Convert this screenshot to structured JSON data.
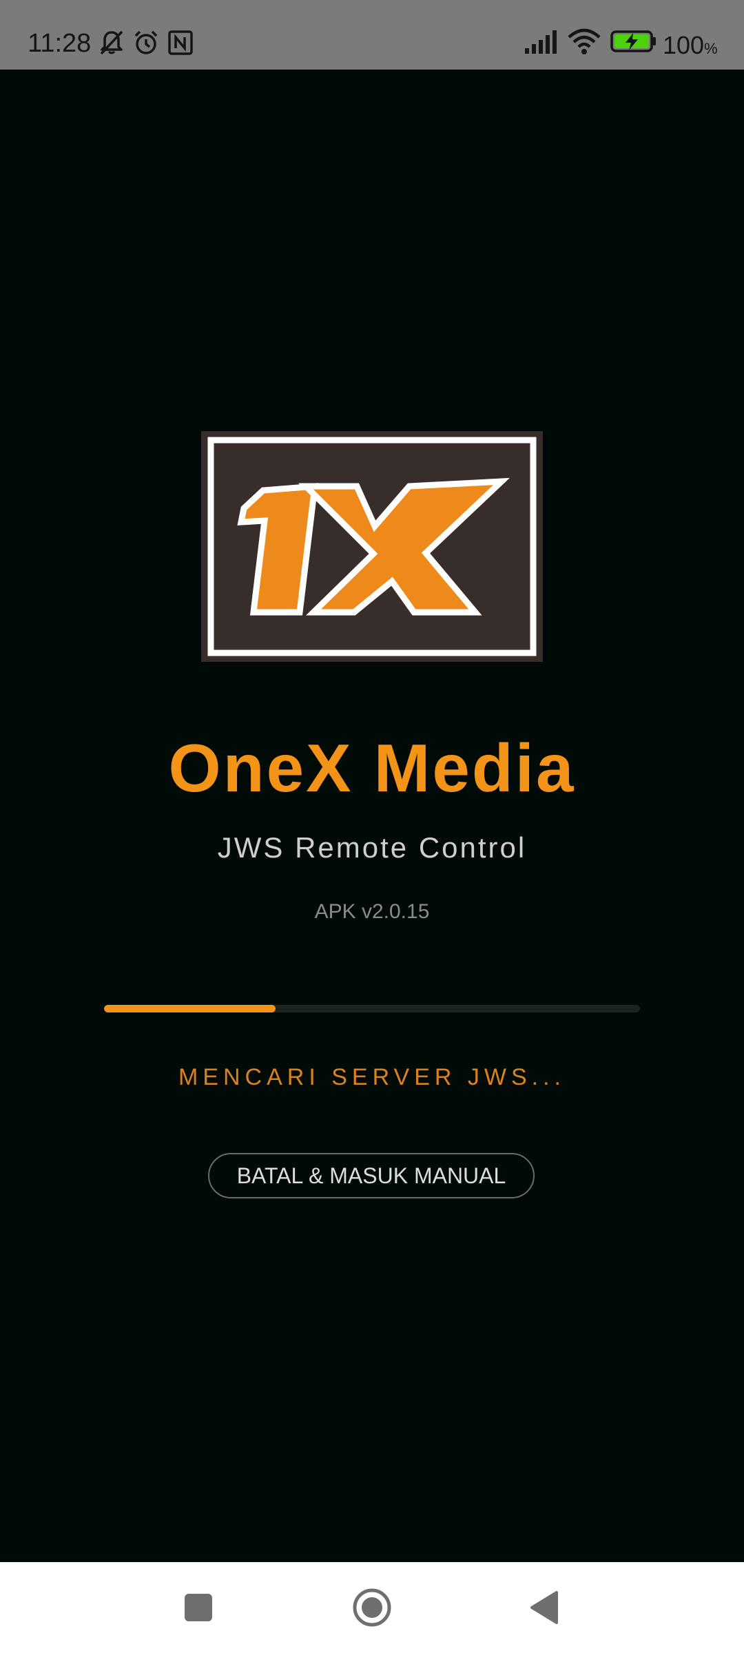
{
  "status_bar": {
    "time": "11:28",
    "battery": "100",
    "battery_unit": "%",
    "icons": [
      "mute-icon",
      "alarm-icon",
      "nfc-icon",
      "signal-icon",
      "wifi-icon",
      "battery-charging-icon"
    ]
  },
  "app": {
    "logo_text": "1X",
    "title": "OneX Media",
    "subtitle": "JWS Remote Control",
    "version": "APK v2.0.15"
  },
  "loading": {
    "progress": 0.32,
    "message": "MENCARI SERVER JWS...",
    "cancel_button_label": "BATAL & MASUK MANUAL"
  },
  "nav_bar": {
    "items": [
      "recents",
      "home",
      "back"
    ]
  },
  "colors": {
    "background": "#000a06",
    "accent": "#f39318",
    "status_bar": "#7b7b7b",
    "logo_box": "#372d2b"
  }
}
